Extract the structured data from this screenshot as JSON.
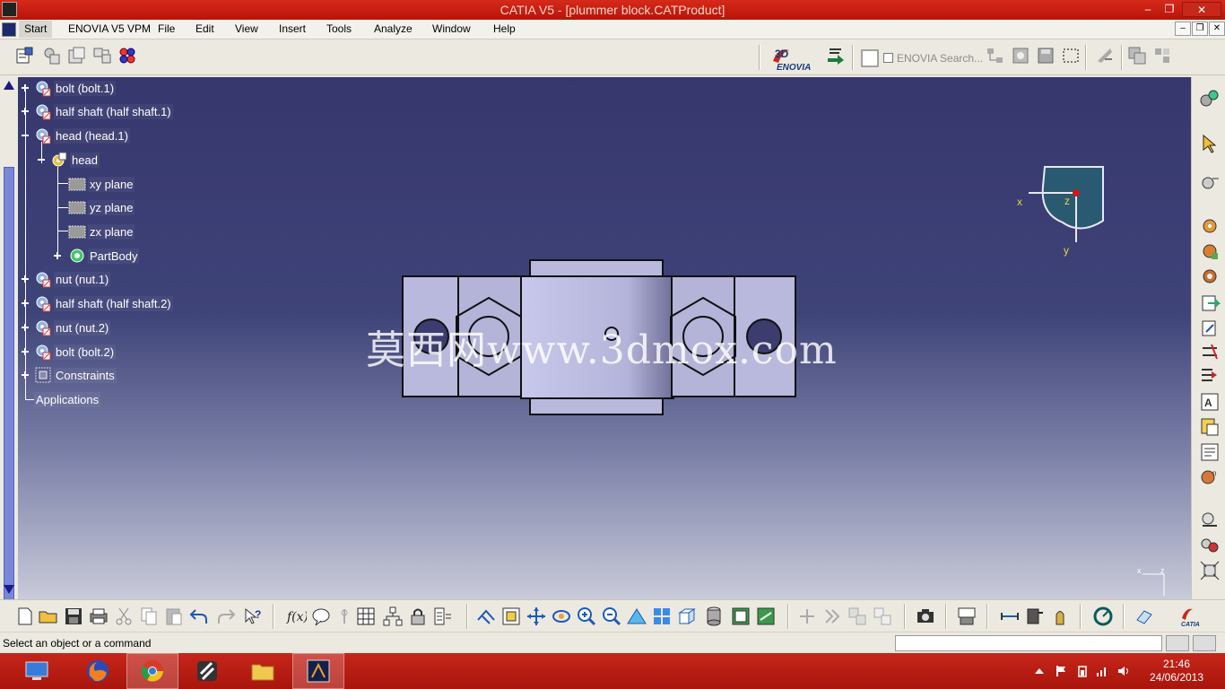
{
  "window": {
    "title": "CATIA V5 - [plummer block.CATProduct]",
    "controls": {
      "minimize": "‒",
      "maximize": "❐",
      "close": "✕"
    }
  },
  "menubar": {
    "items": [
      "Start",
      "ENOVIA V5 VPM",
      "File",
      "Edit",
      "View",
      "Insert",
      "Tools",
      "Analyze",
      "Window",
      "Help"
    ],
    "doc_controls": {
      "minimize": "–",
      "restore": "❐",
      "close": "✕"
    }
  },
  "toolbar_top": {
    "enovia_search_label": "ENOVIA Search..."
  },
  "tree": {
    "items": [
      {
        "label": "bolt (bolt.1)"
      },
      {
        "label": "half shaft (half shaft.1)"
      },
      {
        "label": "head (head.1)"
      },
      {
        "label": "head"
      },
      {
        "label": "xy plane"
      },
      {
        "label": "yz plane"
      },
      {
        "label": "zx plane"
      },
      {
        "label": "PartBody"
      },
      {
        "label": "nut (nut.1)"
      },
      {
        "label": "half shaft (half shaft.2)"
      },
      {
        "label": "nut (nut.2)"
      },
      {
        "label": "bolt (bolt.2)"
      },
      {
        "label": "Constraints"
      },
      {
        "label": "Applications"
      }
    ]
  },
  "viewport": {
    "watermark": "莫西网www.3dmox.com",
    "compass_axes": {
      "x": "x",
      "y": "y",
      "z": "z"
    },
    "mini_axes": {
      "x": "x",
      "z": "z"
    }
  },
  "statusbar": {
    "message": "Select an object or a command",
    "command_input_value": ""
  },
  "taskbar": {
    "time": "21:46",
    "date": "24/06/2013"
  },
  "colors": {
    "titlebar": "#c41f12",
    "taskbar": "#b8150c",
    "viewport_top": "#36376d",
    "viewport_bottom": "#c9cad9",
    "part_fill": "#b9b9dd",
    "compass_fill": "#2a5a72"
  },
  "icons": {
    "tree_product": "product-gear-icon",
    "tree_part": "part-gear-icon",
    "tree_plane": "plane-icon",
    "tree_body": "partbody-gear-icon",
    "tree_constraints": "constraints-icon"
  }
}
